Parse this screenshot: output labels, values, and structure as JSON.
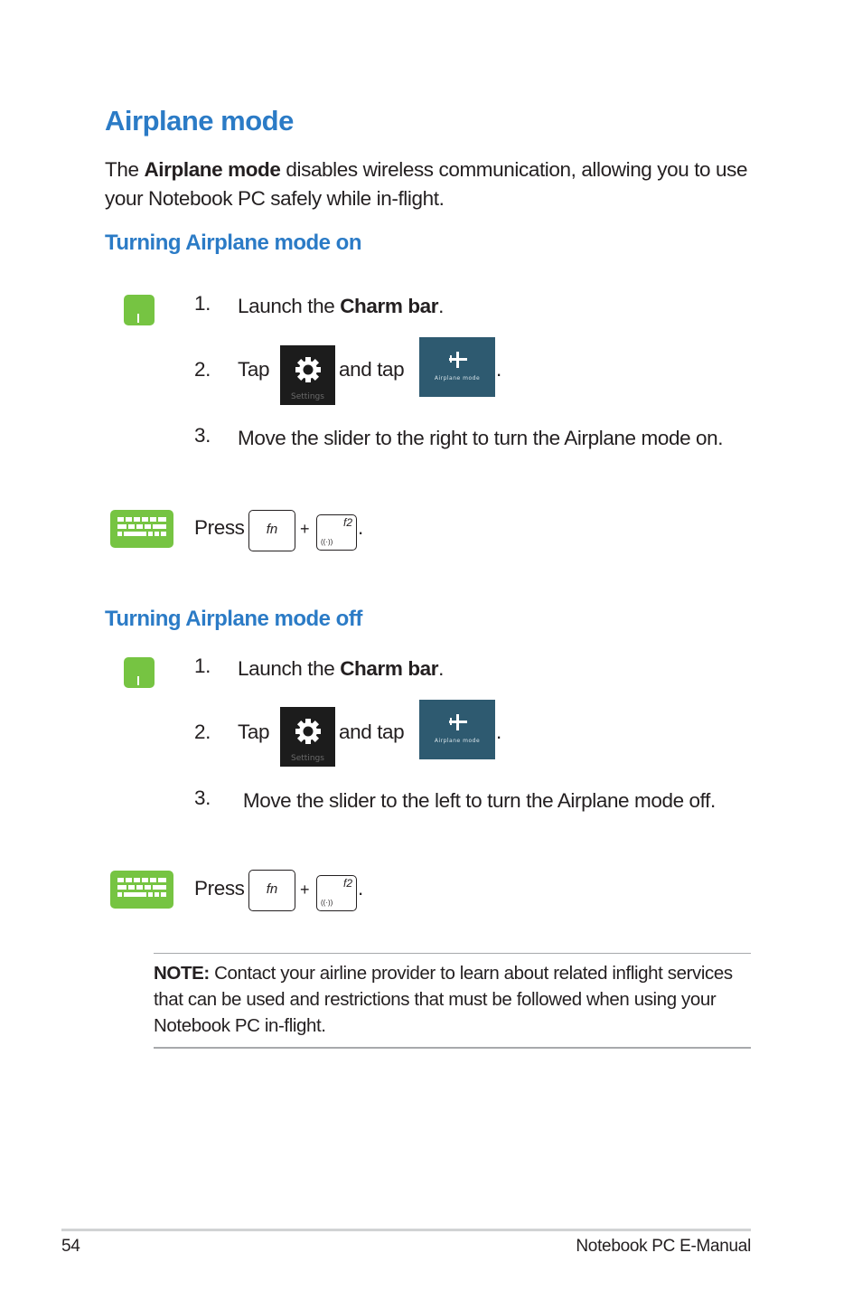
{
  "title": "Airplane mode",
  "intro": {
    "prefix": "The ",
    "bold": "Airplane mode",
    "suffix": " disables wireless communication, allowing you to use your Notebook PC safely while in-flight."
  },
  "sections": [
    {
      "heading": "Turning Airplane mode on",
      "steps": [
        {
          "num": "1.",
          "prefix": "Launch the ",
          "bold": "Charm bar",
          "suffix": "."
        },
        {
          "num": "2.",
          "tap": "Tap",
          "and_tap": "and tap",
          "end": "."
        },
        {
          "num": "3.",
          "text": "Move the slider to the right to turn the Airplane mode on."
        }
      ],
      "keyboard": {
        "press": "Press",
        "plus": "+",
        "end": "."
      }
    },
    {
      "heading": "Turning Airplane mode off",
      "steps": [
        {
          "num": "1.",
          "prefix": "Launch the ",
          "bold": "Charm bar",
          "suffix": "."
        },
        {
          "num": "2.",
          "tap": "Tap",
          "and_tap": "and tap",
          "end": "."
        },
        {
          "num": "3.",
          "text": " Move the slider to the left to turn the Airplane mode off."
        }
      ],
      "keyboard": {
        "press": "Press",
        "plus": "+",
        "end": "."
      }
    }
  ],
  "tiles": {
    "settings_label": "Settings",
    "airplane_label": "Airplane mode"
  },
  "keys": {
    "fn": "fn",
    "f2": "f2",
    "wifi_glyph": "((·))"
  },
  "note": {
    "bold": "NOTE:",
    "text": " Contact your airline provider to learn about related inflight services that can be used and restrictions that must be followed when using your Notebook PC in-flight."
  },
  "footer": {
    "page_number": "54",
    "manual_title": "Notebook PC E-Manual"
  },
  "colors": {
    "heading_blue": "#2b7bc6",
    "icon_green": "#76c442",
    "airplane_tile": "#2e5a70",
    "settings_tile": "#1c1c1c"
  }
}
